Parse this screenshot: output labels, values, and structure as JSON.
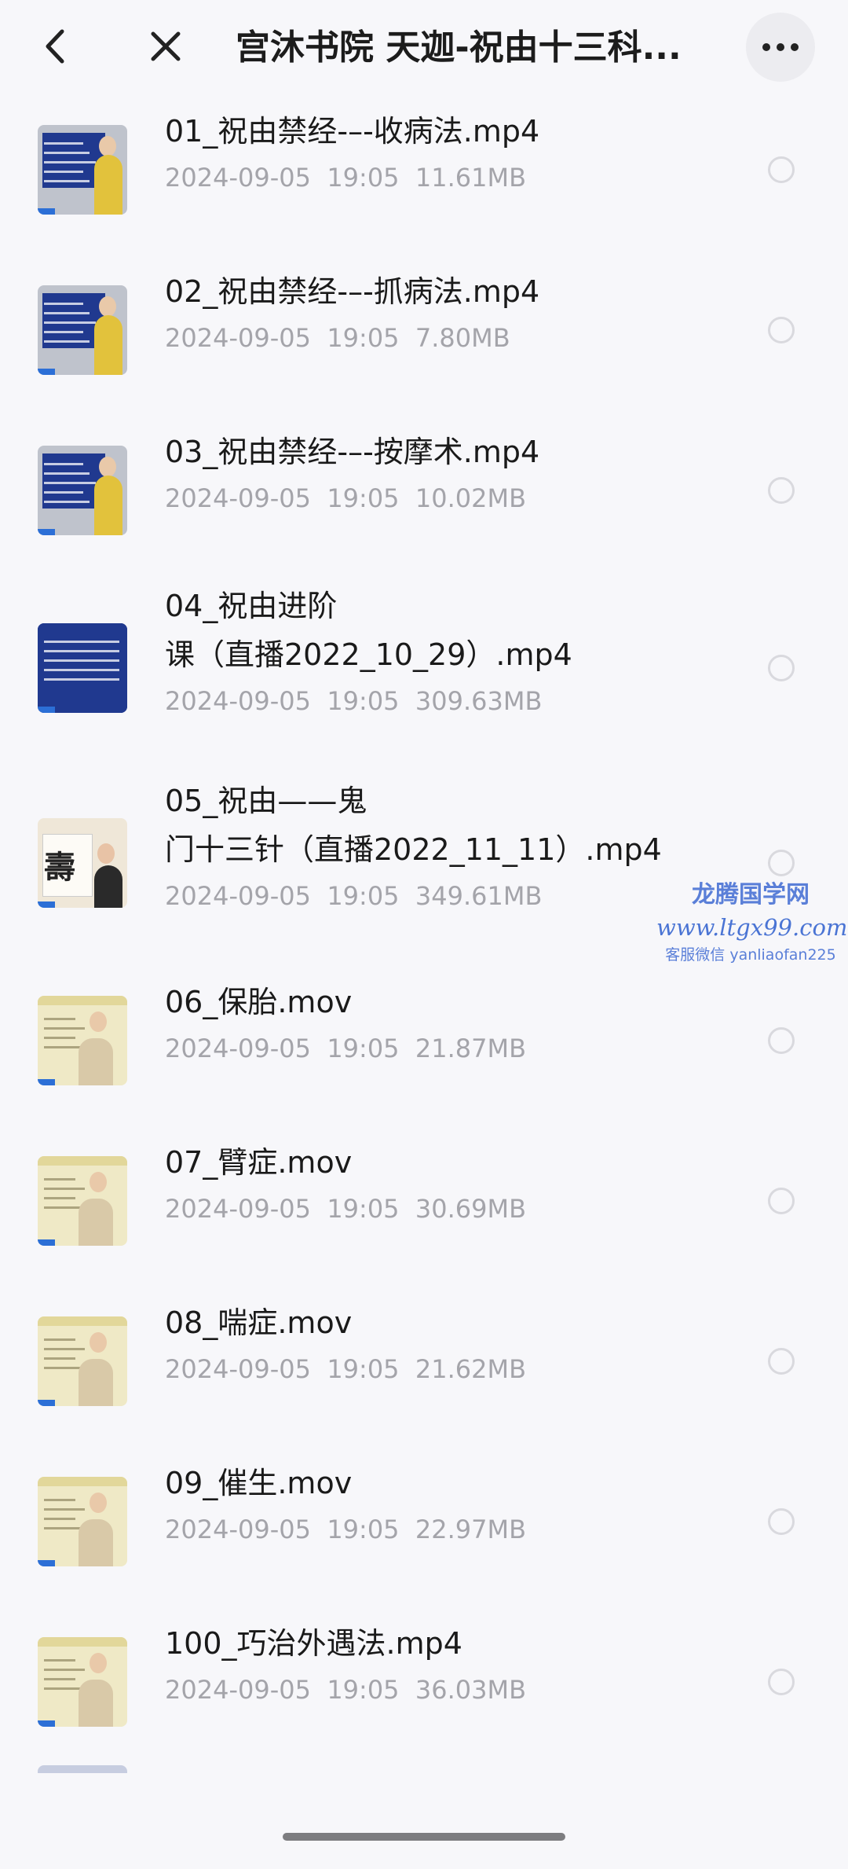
{
  "header": {
    "title": "宫沐书院 天迦-祝由十三科...",
    "back_icon": "chevron-left-icon",
    "close_icon": "close-icon",
    "more_icon": "more-horizontal-icon"
  },
  "files": [
    {
      "name": "01_祝由禁经-–-收病法.mp4",
      "date": "2024-09-05  19:05",
      "size": "11.61MB",
      "thumb_style": "blue-board"
    },
    {
      "name": "02_祝由禁经-–-抓病法.mp4",
      "date": "2024-09-05  19:05",
      "size": "7.80MB",
      "thumb_style": "blue-board"
    },
    {
      "name": "03_祝由禁经-–-按摩术.mp4",
      "date": "2024-09-05  19:05",
      "size": "10.02MB",
      "thumb_style": "blue-board"
    },
    {
      "name": "04_祝由进阶课（直播2022_10_29）.mp4",
      "date": "2024-09-05  19:05",
      "size": "309.63MB",
      "thumb_style": "blue-text"
    },
    {
      "name": "05_祝由——鬼门十三针（直播2022_11_11）.mp4",
      "date": "2024-09-05  19:05",
      "size": "349.61MB",
      "thumb_style": "calligraphy"
    },
    {
      "name": "06_保胎.mov",
      "date": "2024-09-05  19:05",
      "size": "21.87MB",
      "thumb_style": "slide"
    },
    {
      "name": "07_臂症.mov",
      "date": "2024-09-05  19:05",
      "size": "30.69MB",
      "thumb_style": "slide"
    },
    {
      "name": "08_喘症.mov",
      "date": "2024-09-05  19:05",
      "size": "21.62MB",
      "thumb_style": "slide"
    },
    {
      "name": "09_催生.mov",
      "date": "2024-09-05  19:05",
      "size": "22.97MB",
      "thumb_style": "slide"
    },
    {
      "name": "100_巧治外遇法.mp4",
      "date": "2024-09-05  19:05",
      "size": "36.03MB",
      "thumb_style": "slide"
    }
  ],
  "watermark": {
    "line1": "龙腾国学网",
    "line2": "www.ltgx99.com",
    "line3": "客服微信 yanliaofan225"
  },
  "colors": {
    "background": "#f7f7fa",
    "meta_text": "#a4a4aa",
    "watermark": "#5a7fd8"
  }
}
